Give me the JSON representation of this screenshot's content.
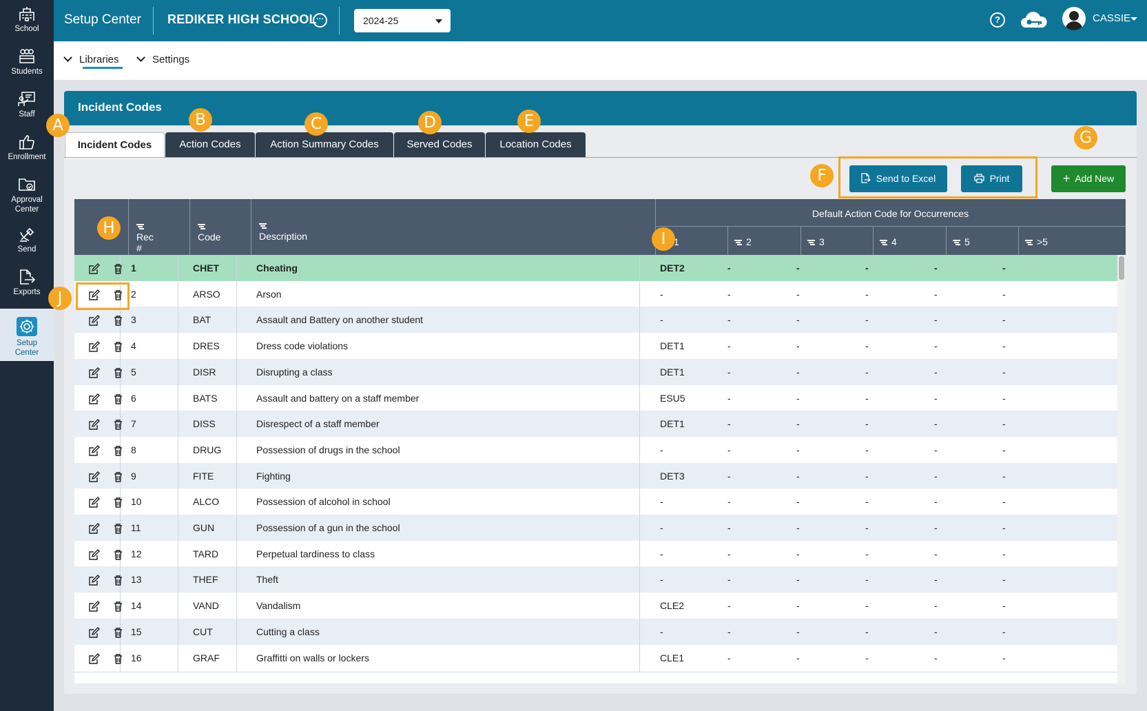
{
  "nav": [
    {
      "label": "School",
      "icon": "school-icon"
    },
    {
      "label": "Students",
      "icon": "students-icon"
    },
    {
      "label": "Staff",
      "icon": "staff-icon"
    },
    {
      "label": "Enrollment",
      "icon": "thumbs-up-icon"
    },
    {
      "label": "Approval Center",
      "icon": "folder-icon"
    },
    {
      "label": "Send",
      "icon": "satellite-icon"
    },
    {
      "label": "Exports",
      "icon": "export-icon"
    },
    {
      "label": "Setup Center",
      "icon": "gear-icon"
    }
  ],
  "header": {
    "app_title": "Setup Center",
    "school": "REDIKER HIGH SCHOOL",
    "school_more": "···",
    "year": "2024-25",
    "help": "?",
    "user": "CASSIE"
  },
  "subnav": {
    "libraries": "Libraries",
    "settings": "Settings"
  },
  "panel": {
    "title": "Incident Codes"
  },
  "tabs": [
    "Incident Codes",
    "Action Codes",
    "Action Summary Codes",
    "Served Codes",
    "Location Codes"
  ],
  "buttons": {
    "excel": "Send to Excel",
    "print": "Print",
    "add": "Add New"
  },
  "badges": {
    "a": "A",
    "b": "B",
    "c": "C",
    "d": "D",
    "e": "E",
    "f": "F",
    "g": "G",
    "h": "H",
    "i": "I",
    "j": "J"
  },
  "table": {
    "headers": {
      "rec": "Rec #",
      "code": "Code",
      "description": "Description",
      "occ_title": "Default Action Code for Occurrences"
    },
    "occ_headers": [
      "1",
      "2",
      "3",
      "4",
      "5",
      ">5"
    ],
    "rows": [
      {
        "rec": "1",
        "code": "CHET",
        "desc": "Cheating",
        "occ": [
          "DET2",
          "-",
          "-",
          "-",
          "-",
          "-"
        ]
      },
      {
        "rec": "2",
        "code": "ARSO",
        "desc": "Arson",
        "occ": [
          "-",
          "-",
          "-",
          "-",
          "-",
          "-"
        ]
      },
      {
        "rec": "3",
        "code": "BAT",
        "desc": "Assault and Battery on another student",
        "occ": [
          "-",
          "-",
          "-",
          "-",
          "-",
          "-"
        ]
      },
      {
        "rec": "4",
        "code": "DRES",
        "desc": "Dress code violations",
        "occ": [
          "DET1",
          "-",
          "-",
          "-",
          "-",
          "-"
        ]
      },
      {
        "rec": "5",
        "code": "DISR",
        "desc": "Disrupting a class",
        "occ": [
          "DET1",
          "-",
          "-",
          "-",
          "-",
          "-"
        ]
      },
      {
        "rec": "6",
        "code": "BATS",
        "desc": "Assault and battery on a staff member",
        "occ": [
          "ESU5",
          "-",
          "-",
          "-",
          "-",
          "-"
        ]
      },
      {
        "rec": "7",
        "code": "DISS",
        "desc": "Disrespect of a staff member",
        "occ": [
          "DET1",
          "-",
          "-",
          "-",
          "-",
          "-"
        ]
      },
      {
        "rec": "8",
        "code": "DRUG",
        "desc": "Possession of drugs in the school",
        "occ": [
          "-",
          "-",
          "-",
          "-",
          "-",
          "-"
        ]
      },
      {
        "rec": "9",
        "code": "FITE",
        "desc": "Fighting",
        "occ": [
          "DET3",
          "-",
          "-",
          "-",
          "-",
          "-"
        ]
      },
      {
        "rec": "10",
        "code": "ALCO",
        "desc": "Possession of alcohol in school",
        "occ": [
          "-",
          "-",
          "-",
          "-",
          "-",
          "-"
        ]
      },
      {
        "rec": "11",
        "code": "GUN",
        "desc": "Possession of a gun in the school",
        "occ": [
          "-",
          "-",
          "-",
          "-",
          "-",
          "-"
        ]
      },
      {
        "rec": "12",
        "code": "TARD",
        "desc": "Perpetual tardiness to class",
        "occ": [
          "-",
          "-",
          "-",
          "-",
          "-",
          "-"
        ]
      },
      {
        "rec": "13",
        "code": "THEF",
        "desc": "Theft",
        "occ": [
          "-",
          "-",
          "-",
          "-",
          "-",
          "-"
        ]
      },
      {
        "rec": "14",
        "code": "VAND",
        "desc": "Vandalism",
        "occ": [
          "CLE2",
          "-",
          "-",
          "-",
          "-",
          "-"
        ]
      },
      {
        "rec": "15",
        "code": "CUT",
        "desc": "Cutting a class",
        "occ": [
          "-",
          "-",
          "-",
          "-",
          "-",
          "-"
        ]
      },
      {
        "rec": "16",
        "code": "GRAF",
        "desc": "Graffitti on walls or lockers",
        "occ": [
          "CLE1",
          "-",
          "-",
          "-",
          "-",
          "-"
        ]
      }
    ]
  },
  "colors": {
    "header": "#0e7597",
    "nav": "#1d2b3a",
    "selected_row": "#a6dfc0",
    "badge": "#f5a623",
    "add_button": "#1e8a2d"
  }
}
